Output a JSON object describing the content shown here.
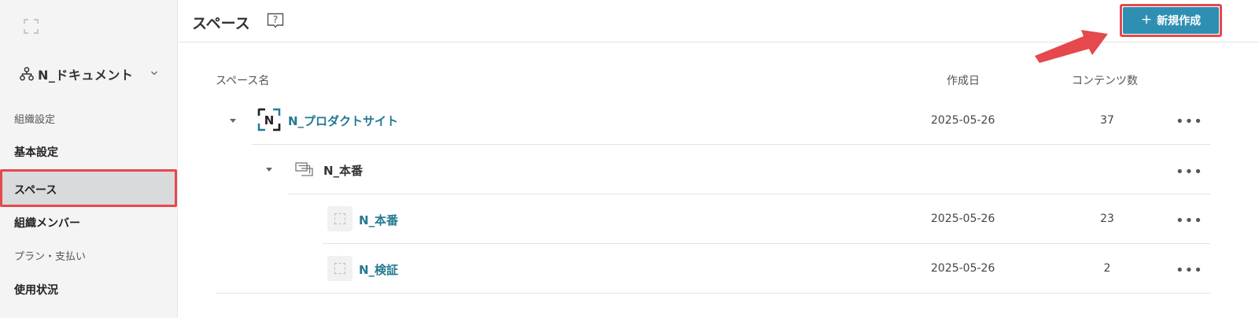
{
  "sidebar": {
    "org_name": "N_ドキュメント",
    "category_org": "組織設定",
    "item_basic": "基本設定",
    "item_space": "スペース",
    "item_members": "組織メンバー",
    "category_plan": "プラン・支払い",
    "item_usage": "使用状況"
  },
  "header": {
    "title": "スペース",
    "create_button": "新規作成",
    "create_button_icon": "+"
  },
  "table": {
    "columns": {
      "name": "スペース名",
      "created": "作成日",
      "count": "コンテンツ数"
    },
    "rows": [
      {
        "name": "N_プロダクトサイト",
        "date": "2025-05-26",
        "count": "37",
        "level": 0,
        "icon": "space-logo-icon"
      },
      {
        "name": "N_本番",
        "date": "",
        "count": "",
        "level": 1,
        "icon": "group-icon"
      },
      {
        "name": "N_本番",
        "date": "2025-05-26",
        "count": "23",
        "level": 2,
        "icon": "placeholder-icon"
      },
      {
        "name": "N_検証",
        "date": "2025-05-26",
        "count": "2",
        "level": 2,
        "icon": "placeholder-icon"
      }
    ],
    "more_label": "•••"
  },
  "colors": {
    "accent": "#2f8fb3",
    "link": "#237a91",
    "highlight": "#e5484d",
    "sidebar_bg": "#f4f4f4",
    "selected_bg": "#d9dadb"
  }
}
